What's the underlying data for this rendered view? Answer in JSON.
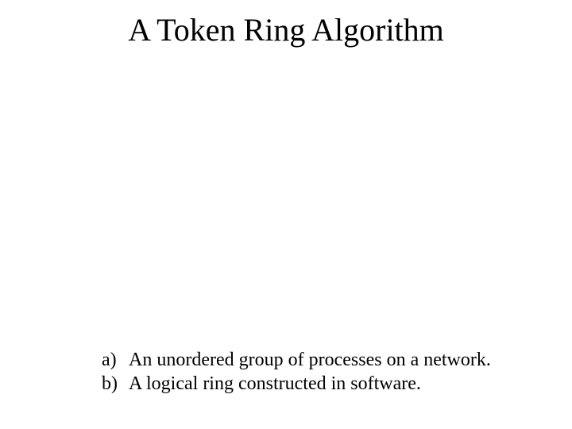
{
  "title": "A Token Ring Algorithm",
  "items": [
    {
      "marker": "a)",
      "text": "An unordered group of processes on a network."
    },
    {
      "marker": "b)",
      "text": "A logical ring constructed in software."
    }
  ]
}
